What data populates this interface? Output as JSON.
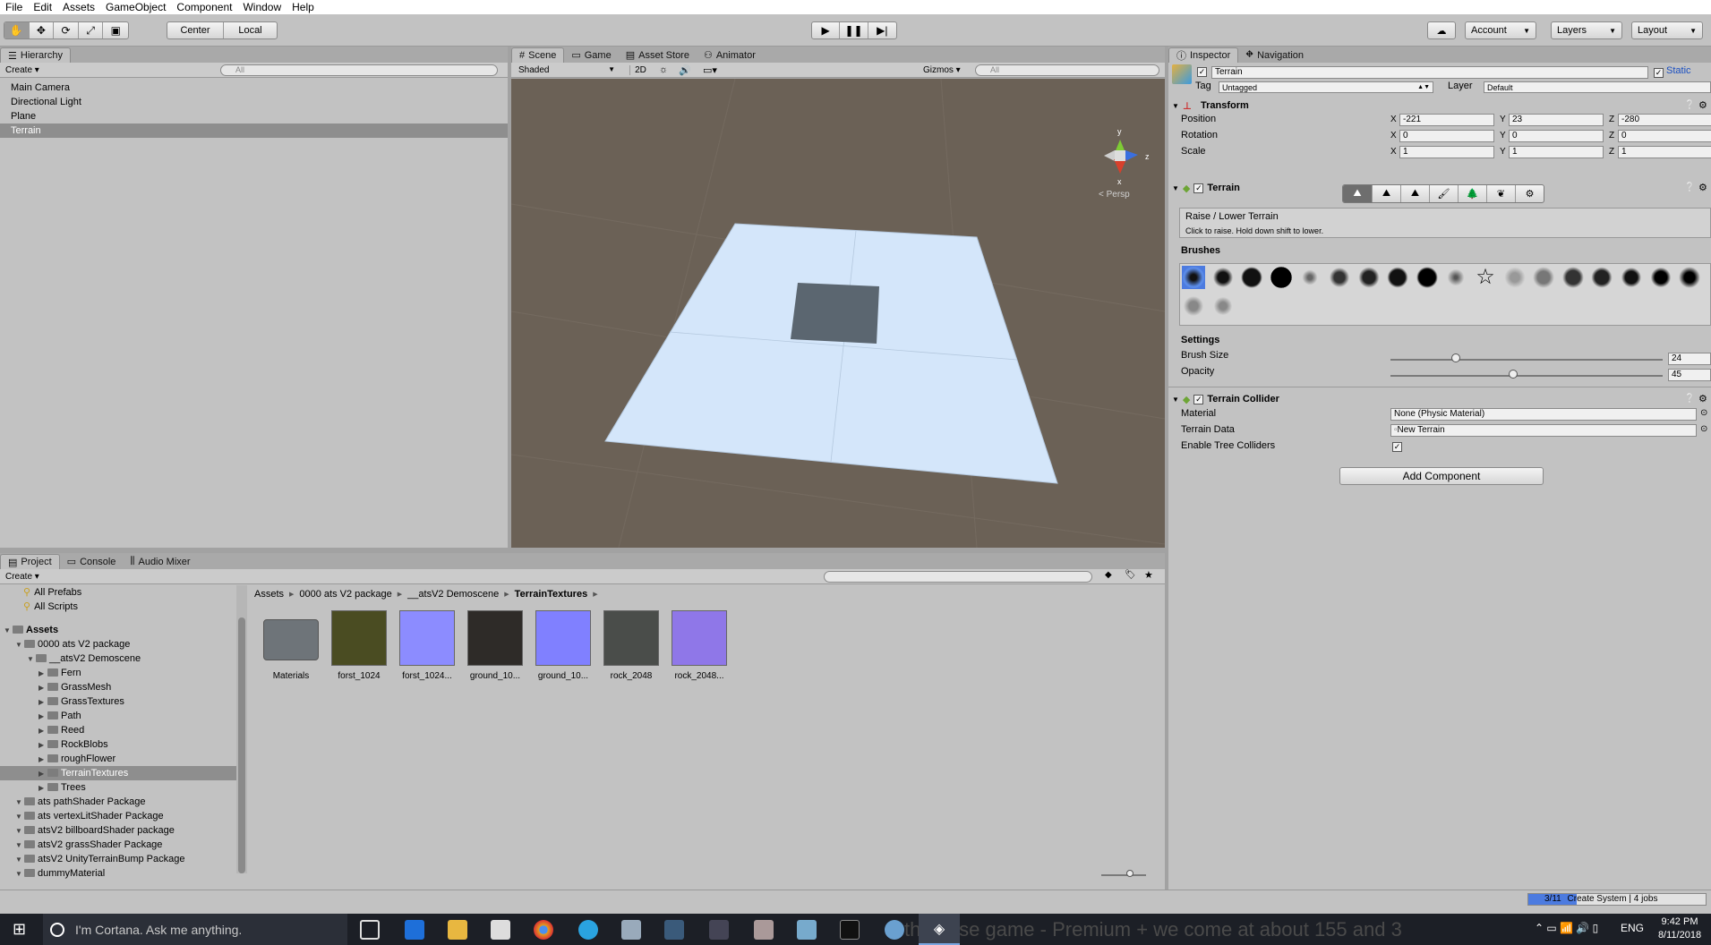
{
  "menu": [
    "File",
    "Edit",
    "Assets",
    "GameObject",
    "Component",
    "Window",
    "Help"
  ],
  "toolbar": {
    "pivot": "Center",
    "space": "Local",
    "account": "Account",
    "layers": "Layers",
    "layout": "Layout"
  },
  "hierarchy": {
    "tab": "Hierarchy",
    "create": "Create",
    "search_placeholder": "All",
    "items": [
      "Main Camera",
      "Directional Light",
      "Plane",
      "Terrain"
    ],
    "selected": "Terrain"
  },
  "scene": {
    "tabs": [
      "Scene",
      "Game",
      "Asset Store",
      "Animator"
    ],
    "shading": "Shaded",
    "mode_2d": "2D",
    "gizmos": "Gizmos",
    "search_placeholder": "All",
    "gizmo_y": "y",
    "gizmo_z": "z",
    "gizmo_x": "x",
    "persp": "< Persp"
  },
  "inspector": {
    "tabs": [
      "Inspector",
      "Navigation"
    ],
    "object_name": "Terrain",
    "static": "Static",
    "tag_label": "Tag",
    "tag_value": "Untagged",
    "layer_label": "Layer",
    "layer_value": "Default",
    "transform": {
      "title": "Transform",
      "position": {
        "label": "Position",
        "x": "-221",
        "y": "23",
        "z": "-280"
      },
      "rotation": {
        "label": "Rotation",
        "x": "0",
        "y": "0",
        "z": "0"
      },
      "scale": {
        "label": "Scale",
        "x": "1",
        "y": "1",
        "z": "1"
      }
    },
    "terrain": {
      "title": "Terrain",
      "tool_title": "Raise / Lower Terrain",
      "tool_help": "Click to raise. Hold down shift to lower.",
      "brushes_label": "Brushes",
      "settings_label": "Settings",
      "brush_size_label": "Brush Size",
      "brush_size": "24",
      "brush_size_fraction": 0.24,
      "opacity_label": "Opacity",
      "opacity": "45",
      "opacity_fraction": 0.45
    },
    "collider": {
      "title": "Terrain Collider",
      "material_label": "Material",
      "material_value": "None (Physic Material)",
      "data_label": "Terrain Data",
      "data_value": "New Terrain",
      "trees_label": "Enable Tree Colliders"
    },
    "add_component": "Add Component"
  },
  "project": {
    "tabs": [
      "Project",
      "Console",
      "Audio Mixer"
    ],
    "create": "Create",
    "favorites": [
      "All Prefabs",
      "All Scripts"
    ],
    "tree": [
      {
        "label": "Assets",
        "depth": 0,
        "bold": true
      },
      {
        "label": "0000 ats V2 package",
        "depth": 1
      },
      {
        "label": "__atsV2 Demoscene",
        "depth": 2
      },
      {
        "label": "Fern",
        "depth": 3
      },
      {
        "label": "GrassMesh",
        "depth": 3
      },
      {
        "label": "GrassTextures",
        "depth": 3
      },
      {
        "label": "Path",
        "depth": 3
      },
      {
        "label": "Reed",
        "depth": 3
      },
      {
        "label": "RockBlobs",
        "depth": 3
      },
      {
        "label": "roughFlower",
        "depth": 3
      },
      {
        "label": "TerrainTextures",
        "depth": 3,
        "selected": true
      },
      {
        "label": "Trees",
        "depth": 3
      },
      {
        "label": "ats pathShader Package",
        "depth": 1
      },
      {
        "label": "ats vertexLitShader Package",
        "depth": 1
      },
      {
        "label": "atsV2 billboardShader package",
        "depth": 1
      },
      {
        "label": "atsV2 grassShader Package",
        "depth": 1
      },
      {
        "label": "atsV2 UnityTerrainBump Package",
        "depth": 1
      },
      {
        "label": "dummyMaterial",
        "depth": 1
      }
    ],
    "breadcrumb": [
      "Assets",
      "0000 ats V2 package",
      "__atsV2 Demoscene",
      "TerrainTextures"
    ],
    "assets": [
      {
        "label": "Materials",
        "color": "#6e7479"
      },
      {
        "label": "forst_1024",
        "color": "#4a4c22"
      },
      {
        "label": "forst_1024...",
        "color": "#8c8cff"
      },
      {
        "label": "ground_10...",
        "color": "#2e2b28"
      },
      {
        "label": "ground_10...",
        "color": "#8080ff"
      },
      {
        "label": "rock_2048",
        "color": "#4a4d4a"
      },
      {
        "label": "rock_2048...",
        "color": "#8f77e8"
      }
    ]
  },
  "status": {
    "progress": "3/11",
    "task": "Create System | 4 jobs"
  },
  "taskbar": {
    "cortana": "I'm Cortana. Ask me anything.",
    "lang": "ENG",
    "time": "9:42 PM",
    "date": "8/11/2018",
    "wallpaper_text": "the base game - Premium + we come at about 155 and 3"
  },
  "colors": {
    "panel": "#c2c2c2",
    "scene_bg": "#6b6156",
    "terrain_plane": "#d4e6fa",
    "accent_blue": "#3b73d6"
  }
}
